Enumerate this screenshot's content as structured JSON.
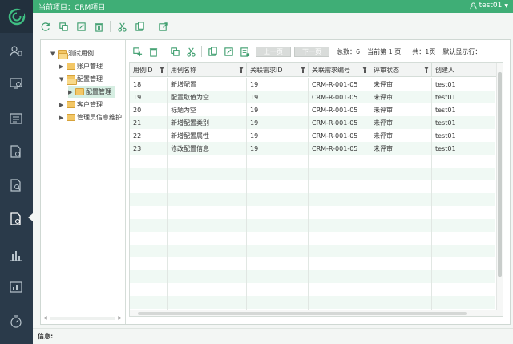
{
  "header": {
    "project_title": "当前项目：CRM项目",
    "user": "test01"
  },
  "sidebar": {
    "items": [
      {
        "icon": "user-settings-icon"
      },
      {
        "icon": "monitor-icon"
      },
      {
        "icon": "report-icon"
      },
      {
        "icon": "document-settings-icon"
      },
      {
        "icon": "document-search-icon"
      },
      {
        "icon": "test-case-icon",
        "active": true
      },
      {
        "icon": "bar-chart-icon"
      },
      {
        "icon": "statistics-icon"
      },
      {
        "icon": "gauge-icon"
      }
    ]
  },
  "main_toolbar": {
    "buttons": [
      "refresh-icon",
      "copy-node-icon",
      "edit-icon",
      "delete-icon",
      "cut-icon",
      "paste-icon",
      "export-icon"
    ]
  },
  "tree": {
    "nodes": [
      {
        "label": "测试用例",
        "level": 0,
        "expanded": true
      },
      {
        "label": "账户管理",
        "level": 1,
        "expanded": false
      },
      {
        "label": "配置管理",
        "level": 1,
        "expanded": true
      },
      {
        "label": "配置管理",
        "level": 2,
        "expanded": false,
        "selected": true
      },
      {
        "label": "客户管理",
        "level": 1,
        "expanded": false
      },
      {
        "label": "管理员信息维护",
        "level": 1,
        "expanded": false
      }
    ]
  },
  "grid_toolbar": {
    "prev_label": "上一页",
    "next_label": "下一页",
    "total_label": "总数：6",
    "current_page_label": "当前第 1 页",
    "total_pages_label": "共：1页",
    "default_display_label": "默认显示行："
  },
  "grid": {
    "columns": [
      "用例ID",
      "用例名称",
      "关联需求ID",
      "关联需求编号",
      "评审状态",
      "创建人"
    ],
    "rows": [
      {
        "id": "18",
        "name": "新增配置",
        "req_id": "19",
        "req_no": "CRM-R-001-05",
        "status": "未评审",
        "creator": "test01"
      },
      {
        "id": "19",
        "name": "配置取值为空",
        "req_id": "19",
        "req_no": "CRM-R-001-05",
        "status": "未评审",
        "creator": "test01"
      },
      {
        "id": "20",
        "name": "标题为空",
        "req_id": "19",
        "req_no": "CRM-R-001-05",
        "status": "未评审",
        "creator": "test01"
      },
      {
        "id": "21",
        "name": "新增配置类别",
        "req_id": "19",
        "req_no": "CRM-R-001-05",
        "status": "未评审",
        "creator": "test01"
      },
      {
        "id": "22",
        "name": "新增配置属性",
        "req_id": "19",
        "req_no": "CRM-R-001-05",
        "status": "未评审",
        "creator": "test01"
      },
      {
        "id": "23",
        "name": "修改配置信息",
        "req_id": "19",
        "req_no": "CRM-R-001-05",
        "status": "未评审",
        "creator": "test01"
      }
    ]
  },
  "infobar": {
    "label": "信息:"
  },
  "colors": {
    "header_green": "#3fae76",
    "sidebar_dark": "#2a3a4a",
    "row_alt": "#f0f9f4"
  }
}
